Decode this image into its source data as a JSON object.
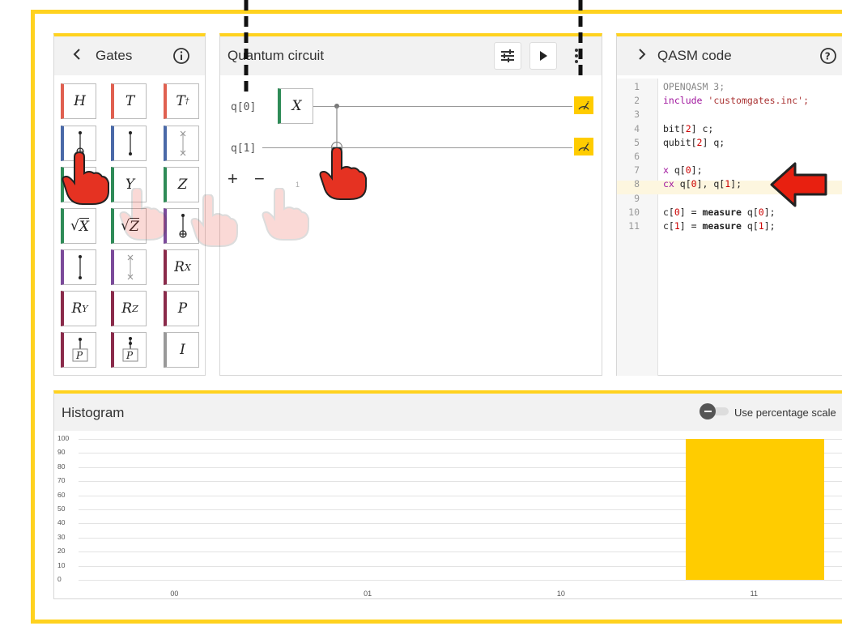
{
  "gates_panel": {
    "title": "Gates",
    "gates": [
      {
        "label": "H",
        "color": "red"
      },
      {
        "label": "T",
        "color": "red"
      },
      {
        "label": "T†",
        "color": "red"
      },
      {
        "label": "cnot",
        "color": "blue"
      },
      {
        "label": "cz",
        "color": "blue"
      },
      {
        "label": "swap",
        "color": "blue"
      },
      {
        "label": "X",
        "color": "green"
      },
      {
        "label": "Y",
        "color": "green"
      },
      {
        "label": "Z",
        "color": "green"
      },
      {
        "label": "√X",
        "color": "green"
      },
      {
        "label": "√Z",
        "color": "green"
      },
      {
        "label": "cnot2",
        "color": "purple"
      },
      {
        "label": "cz2",
        "color": "purple"
      },
      {
        "label": "swap2",
        "color": "purple"
      },
      {
        "label": "RX",
        "color": "maroon"
      },
      {
        "label": "RY",
        "color": "maroon"
      },
      {
        "label": "RZ",
        "color": "maroon"
      },
      {
        "label": "P",
        "color": "maroon"
      },
      {
        "label": "CP",
        "color": "maroon"
      },
      {
        "label": "CCP",
        "color": "maroon"
      },
      {
        "label": "I",
        "color": "gray"
      }
    ]
  },
  "circuit_panel": {
    "title": "Quantum circuit",
    "qubits": [
      "q[0]",
      "q[1]"
    ],
    "gate_label": "X",
    "add_label": "+",
    "remove_label": "−",
    "step_label": "1"
  },
  "qasm_panel": {
    "title": "QASM code",
    "highlighted_line": 8,
    "lines": [
      {
        "n": "1",
        "text": "OPENQASM 3;"
      },
      {
        "n": "2",
        "text": "include 'customgates.inc';"
      },
      {
        "n": "3",
        "text": ""
      },
      {
        "n": "4",
        "text": "bit[2] c;"
      },
      {
        "n": "5",
        "text": "qubit[2] q;"
      },
      {
        "n": "6",
        "text": ""
      },
      {
        "n": "7",
        "text": "x q[0];"
      },
      {
        "n": "8",
        "text": "cx q[0], q[1];"
      },
      {
        "n": "9",
        "text": ""
      },
      {
        "n": "10",
        "text": "c[0] = measure q[0];"
      },
      {
        "n": "11",
        "text": "c[1] = measure q[1];"
      }
    ]
  },
  "histogram": {
    "title": "Histogram",
    "toggle_label": "Use percentage scale"
  },
  "chart_data": {
    "type": "bar",
    "categories": [
      "00",
      "01",
      "10",
      "11"
    ],
    "values": [
      0,
      0,
      0,
      100
    ],
    "ylim": [
      0,
      100
    ],
    "yticks": [
      "0",
      "10",
      "20",
      "30",
      "40",
      "50",
      "60",
      "70",
      "80",
      "90",
      "100"
    ],
    "bar_color": "#ffcc00"
  },
  "colors": {
    "accent": "#ffd21f",
    "measure": "#ffcc00",
    "arrow": "#e82010"
  }
}
